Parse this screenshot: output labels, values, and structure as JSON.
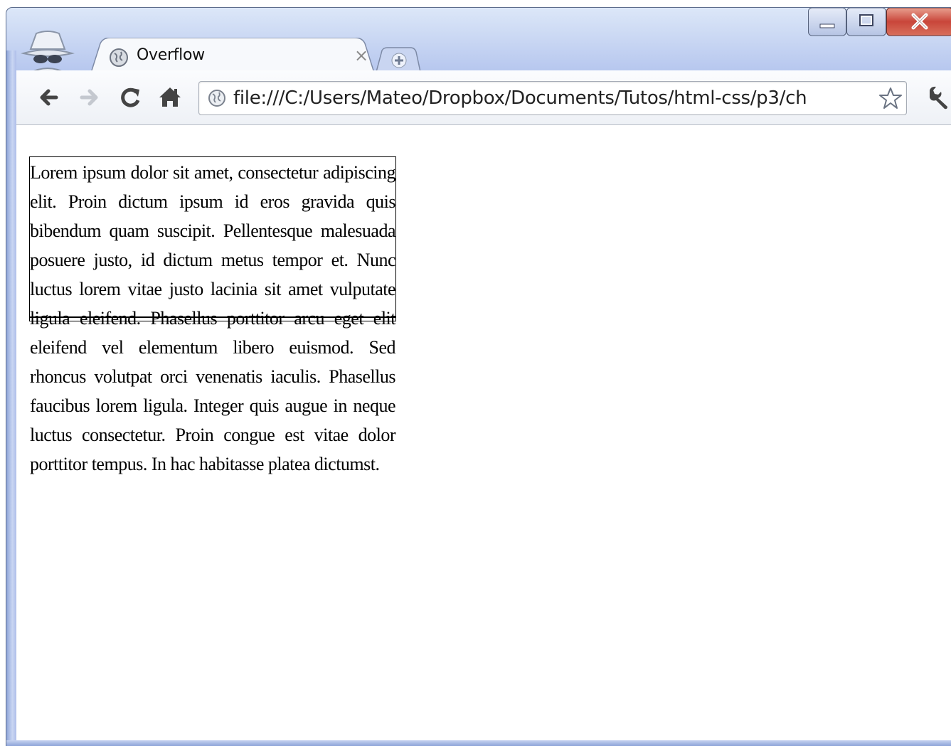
{
  "browser": {
    "tab": {
      "title": "Overflow",
      "close": "×"
    },
    "address_bar": {
      "url": "file:///C:/Users/Mateo/Dropbox/Documents/Tutos/html-css/p3/ch"
    }
  },
  "page": {
    "paragraph": "Lorem ipsum dolor sit amet, consectetur adipiscing elit. Proin dictum ipsum id eros gravida quis bibendum quam suscipit. Pellentesque malesuada posuere justo, id dictum metus tempor et. Nunc luctus lorem vitae justo lacinia sit amet vulputate ligula eleifend. Phasellus porttitor arcu eget elit eleifend vel elementum libero euismod. Sed rhoncus volutpat orci venenatis iaculis. Phasellus faucibus lorem ligula. Integer quis augue in neque luctus consectetur. Proin congue est vitae dolor porttitor tempus. In hac habitasse platea dictumst."
  },
  "icons": {
    "incognito": "incognito-icon",
    "favicon": "globe-icon",
    "new_tab": "plus-icon",
    "back": "back-arrow-icon",
    "forward": "forward-arrow-icon",
    "reload": "reload-icon",
    "home": "home-icon",
    "page_info": "globe-icon",
    "bookmark": "star-icon",
    "settings": "wrench-icon",
    "minimize": "minimize-icon",
    "maximize": "maximize-icon",
    "close": "close-icon"
  },
  "colors": {
    "frame": "#b8c8ef",
    "close_button": "#c75050",
    "toolbar": "#f4f6fa"
  }
}
